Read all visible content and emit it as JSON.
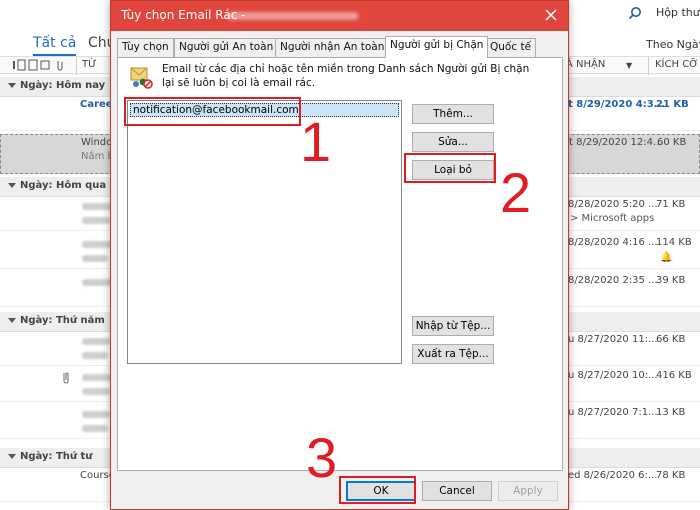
{
  "background": {
    "search_label": "Hộp thư",
    "tabs": {
      "all": "Tất cả",
      "unread": "Chư"
    },
    "sort_label": "Theo Ngày",
    "columns": {
      "from": "TỪ",
      "received": "Á NHẬN",
      "size": "KÍCH CỠ"
    },
    "groups": [
      {
        "label": "Ngày: Hôm nay"
      },
      {
        "label": "Ngày: Hôm qua"
      },
      {
        "label": "Ngày: Thứ năm"
      },
      {
        "label": "Ngày: Thứ tư"
      }
    ],
    "rows": [
      {
        "from": "Career",
        "date": "t 8/29/2020 4:3...",
        "size": "21 KB"
      },
      {
        "from": "Windo",
        "sub": "Nắm b",
        "date": "t 8/29/2020 12:4...",
        "size": "60 KB"
      },
      {
        "date": "8/28/2020 5:20 ...",
        "size": "71 KB",
        "extra": "> Microsoft apps"
      },
      {
        "date": "8/28/2020 4:16 ...",
        "size": "114 KB"
      },
      {
        "date": "8/28/2020 2:35 ...",
        "size": "39 KB"
      },
      {
        "date": "u 8/27/2020 11:...",
        "size": "66 KB"
      },
      {
        "date": "u 8/27/2020 10:...",
        "size": "416 KB"
      },
      {
        "date": "u 8/27/2020 7:1...",
        "size": "13 KB"
      },
      {
        "from": "Course",
        "date": "ed 8/26/2020 6:...",
        "size": "78 KB"
      }
    ]
  },
  "dialog": {
    "title": "Tùy chọn Email Rác -",
    "close_glyph": "✕",
    "tabs": [
      {
        "label": "Tùy chọn",
        "active": false
      },
      {
        "label": "Người gửi An toàn",
        "active": false
      },
      {
        "label": "Người nhận An toàn",
        "active": false
      },
      {
        "label": "Người gửi bị Chặn",
        "active": true
      },
      {
        "label": "Quốc tế",
        "active": false
      }
    ],
    "info_text": "Email từ các địa chỉ hoặc tên miền trong Danh sách Người gửi Bị chặn lại sẽ luôn bị coi là email rác.",
    "blocked_list": [
      "notification@facebookmail.com"
    ],
    "buttons": {
      "add": "Thêm...",
      "edit": "Sửa...",
      "remove": "Loại bỏ",
      "import": "Nhập từ Tệp...",
      "export": "Xuất ra Tệp..."
    },
    "footer": {
      "ok": "OK",
      "cancel": "Cancel",
      "apply": "Apply"
    }
  },
  "annotations": {
    "step1": "1",
    "step2": "2",
    "step3": "3"
  },
  "colors": {
    "title_bar": "#e0463d",
    "highlight": "#e11b22",
    "selection": "#cce4f7",
    "link_blue": "#1f5fa8"
  }
}
